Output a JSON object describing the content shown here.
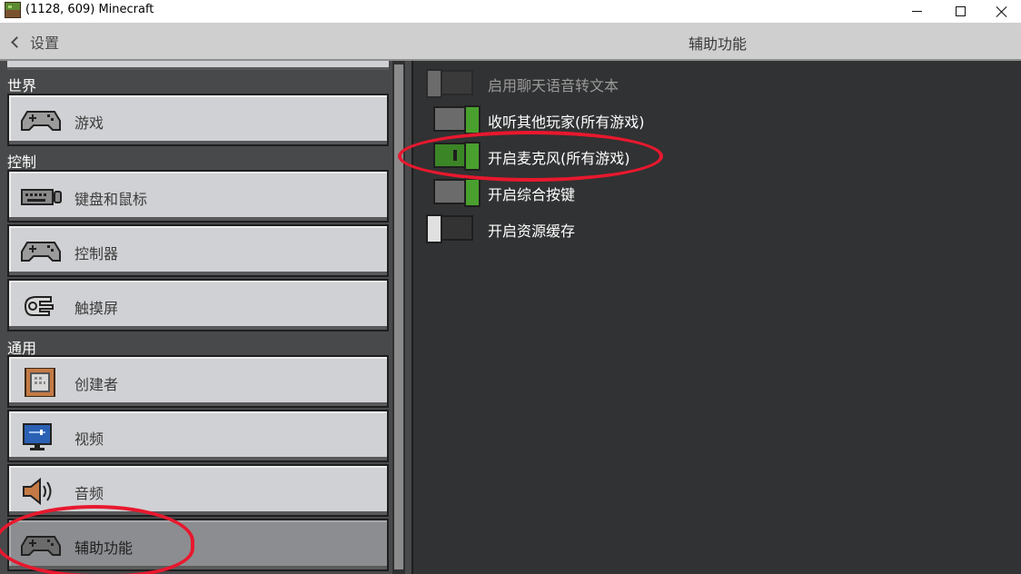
{
  "window": {
    "title": "(1128, 609) Minecraft"
  },
  "header": {
    "back_label": "设置",
    "title": "辅助功能"
  },
  "sidebar": {
    "sections": [
      {
        "label": "世界"
      },
      {
        "label": "控制"
      },
      {
        "label": "通用"
      }
    ],
    "items": [
      {
        "label": "游戏",
        "icon": "gamepad-icon"
      },
      {
        "label": "键盘和鼠标",
        "icon": "keyboard-icon"
      },
      {
        "label": "控制器",
        "icon": "controller-icon"
      },
      {
        "label": "触摸屏",
        "icon": "touch-hand-icon"
      },
      {
        "label": "创建者",
        "icon": "command-block-icon"
      },
      {
        "label": "视频",
        "icon": "monitor-icon"
      },
      {
        "label": "音频",
        "icon": "speaker-icon"
      },
      {
        "label": "辅助功能",
        "icon": "accessibility-controller-icon",
        "selected": true
      }
    ]
  },
  "settings": [
    {
      "label": "启用聊天语音转文本",
      "state": "off",
      "enabled": false
    },
    {
      "label": "收听其他玩家(所有游戏)",
      "state": "on",
      "enabled": true
    },
    {
      "label": "开启麦克风(所有游戏)",
      "state": "on",
      "enabled": true,
      "highlighted": true
    },
    {
      "label": "开启综合按键",
      "state": "on",
      "enabled": true
    },
    {
      "label": "开启资源缓存",
      "state": "off",
      "enabled": true
    }
  ],
  "colors": {
    "annotation": "#e8182e",
    "toggle_on": "#3c8527",
    "panel_dark": "#313233",
    "button_light": "#d0d1d4"
  }
}
